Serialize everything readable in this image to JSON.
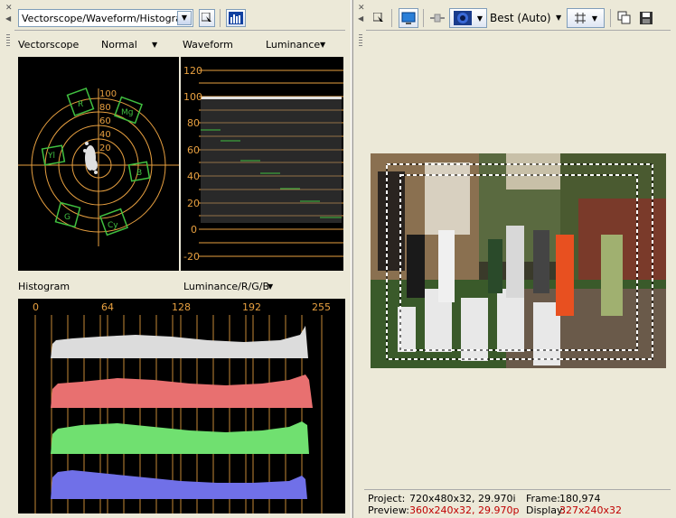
{
  "left_toolbar": {
    "layout_select_value": "Vectorscope/Waveform/Histogram"
  },
  "vectorscope": {
    "title": "Vectorscope",
    "mode": "Normal",
    "rings": [
      "100",
      "80",
      "60",
      "40",
      "20"
    ],
    "targets": [
      "R",
      "Mg",
      "B",
      "Cy",
      "G",
      "Yl"
    ]
  },
  "waveform": {
    "title": "Waveform",
    "mode": "Luminance",
    "ticks": [
      "120",
      "100",
      "80",
      "60",
      "40",
      "20",
      "0",
      "-20"
    ]
  },
  "histogram": {
    "title": "Histogram",
    "mode": "Luminance/R/G/B",
    "ticks": [
      "0",
      "64",
      "128",
      "192",
      "255"
    ],
    "channels": [
      {
        "name": "Luminance",
        "color": "#dcdcdc"
      },
      {
        "name": "R",
        "color": "#e87070"
      },
      {
        "name": "G",
        "color": "#70e070"
      },
      {
        "name": "B",
        "color": "#7070e8"
      }
    ]
  },
  "right_toolbar": {
    "quality": "Best (Auto)"
  },
  "status": {
    "project_label": "Project:",
    "project_value": "720x480x32, 29.970i",
    "frame_label": "Frame:",
    "frame_value": "180,974",
    "preview_label": "Preview:",
    "preview_value": "360x240x32, 29.970p",
    "display_label": "Display:",
    "display_value": "327x240x32"
  },
  "colors": {
    "scope_orange": "#e8a040",
    "target_green": "#40c040",
    "status_red": "#c00000"
  }
}
